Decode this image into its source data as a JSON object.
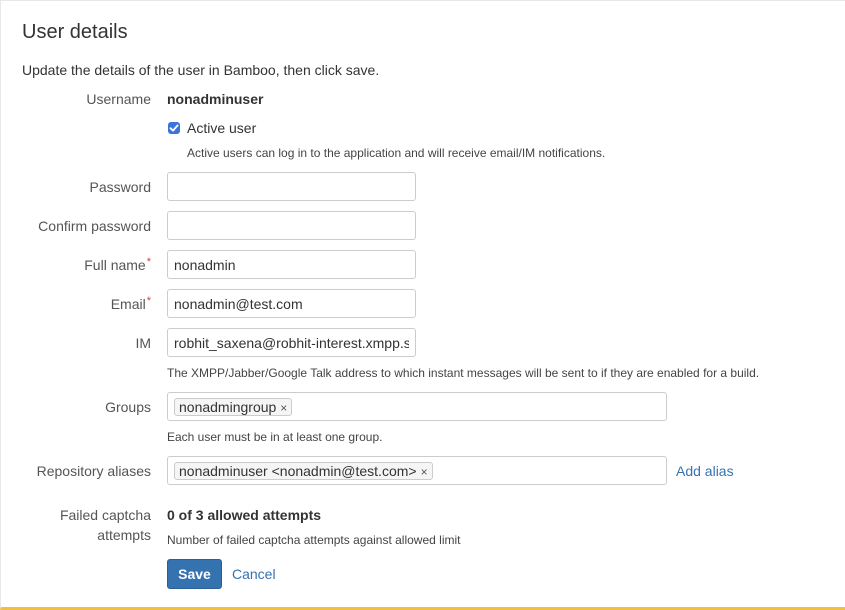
{
  "header": {
    "title": "User details",
    "description": "Update the details of the user in Bamboo, then click save."
  },
  "form": {
    "username": {
      "label": "Username",
      "value": "nonadminuser"
    },
    "active_user": {
      "label": "Active user",
      "checked": true,
      "help": "Active users can log in to the application and will receive email/IM notifications."
    },
    "password": {
      "label": "Password",
      "value": ""
    },
    "confirm_password": {
      "label": "Confirm password",
      "value": ""
    },
    "full_name": {
      "label": "Full name",
      "required_marker": "*",
      "value": "nonadmin"
    },
    "email": {
      "label": "Email",
      "required_marker": "*",
      "value": "nonadmin@test.com"
    },
    "im": {
      "label": "IM",
      "value": "robhit_saxena@robhit-interest.xmpp.sl",
      "help": "The XMPP/Jabber/Google Talk address to which instant messages will be sent to if they are enabled for a build."
    },
    "groups": {
      "label": "Groups",
      "tags": [
        "nonadmingroup"
      ],
      "help": "Each user must be in at least one group."
    },
    "repository_aliases": {
      "label": "Repository aliases",
      "tags": [
        "nonadminuser <nonadmin@test.com>"
      ],
      "add_link": "Add alias"
    },
    "failed_captcha": {
      "label_line1": "Failed captcha",
      "label_line2": "attempts",
      "value": "0 of 3 allowed attempts",
      "help": "Number of failed captcha attempts against allowed limit"
    }
  },
  "actions": {
    "save_label": "Save",
    "cancel_label": "Cancel"
  },
  "icons": {
    "tag_remove": "×"
  },
  "colors": {
    "accent": "#3572b0",
    "required": "#d04437",
    "checkbox": "#3b73d9"
  }
}
